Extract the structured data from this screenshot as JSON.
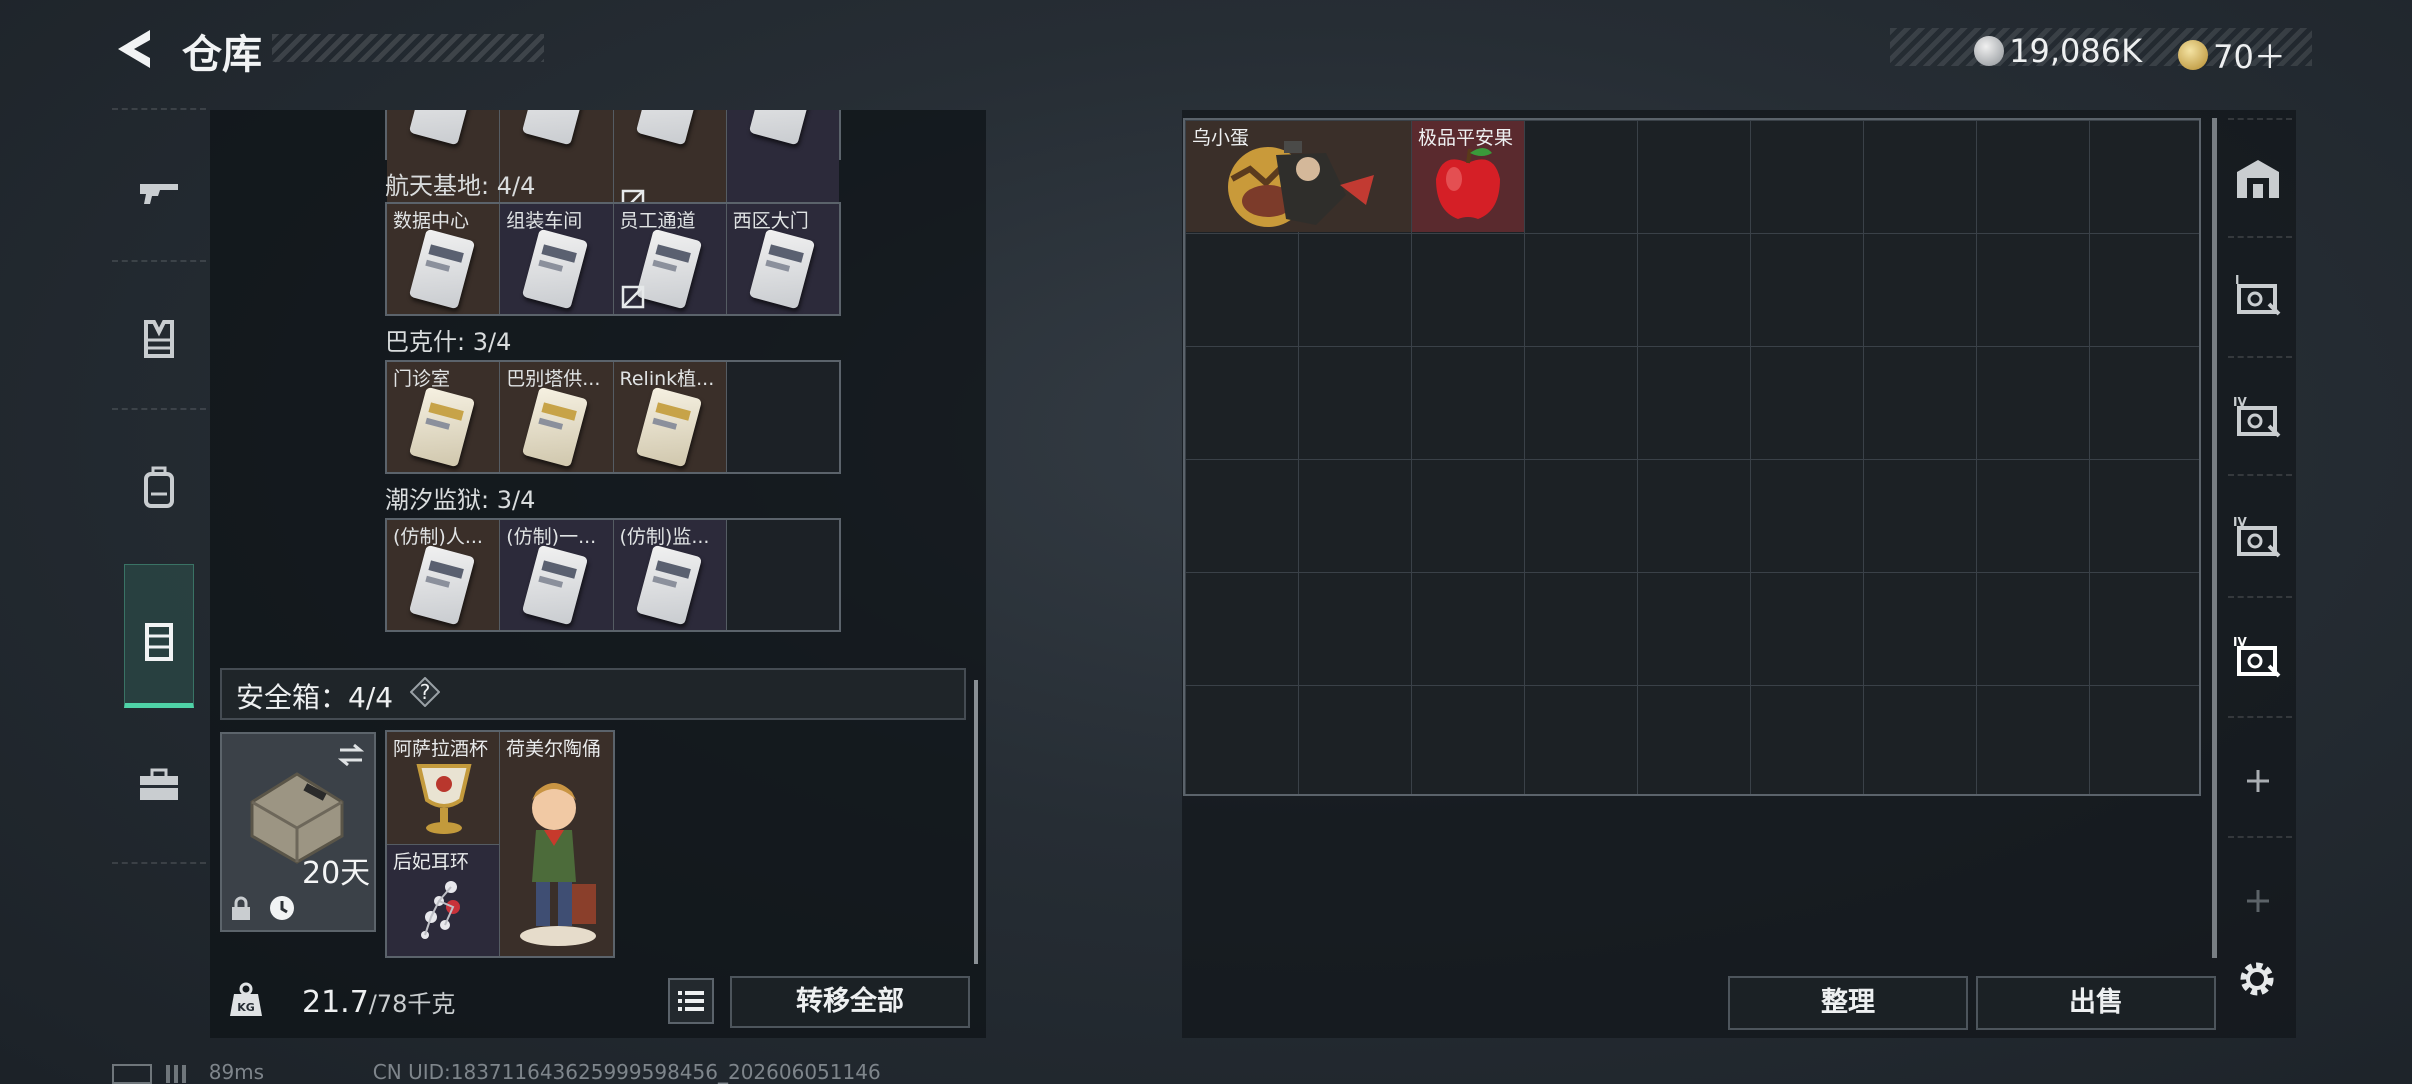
{
  "header": {
    "title": "仓库",
    "currency_1": "19,086K",
    "currency_2": "70＋"
  },
  "left_nav": {
    "items": [
      "weapon-icon",
      "vest-icon",
      "backpack-icon",
      "storage-icon",
      "toolbox-icon"
    ],
    "active": "storage-icon"
  },
  "keys": {
    "top_row_partial": [
      {
        "name": "",
        "color": "brown",
        "broken": false
      },
      {
        "name": "",
        "color": "brown",
        "broken": false
      },
      {
        "name": "",
        "color": "brown",
        "broken": true
      },
      {
        "name": "",
        "color": "purple",
        "broken": false
      }
    ],
    "sections": [
      {
        "label": "航天基地: 4/4",
        "items": [
          {
            "name": "数据中心",
            "color": "brown",
            "broken": false
          },
          {
            "name": "组装车间",
            "color": "purple",
            "broken": false
          },
          {
            "name": "员工通道",
            "color": "purple",
            "broken": true
          },
          {
            "name": "西区大门",
            "color": "purple",
            "broken": false
          }
        ]
      },
      {
        "label": "巴克什: 3/4",
        "items": [
          {
            "name": "门诊室",
            "color": "brown",
            "broken": false
          },
          {
            "name": "巴别塔供...",
            "color": "brown",
            "broken": false
          },
          {
            "name": "Relink植...",
            "color": "brown",
            "broken": false
          }
        ]
      },
      {
        "label": "潮汐监狱: 3/4",
        "items": [
          {
            "name": "(仿制)人...",
            "color": "brown",
            "broken": false
          },
          {
            "name": "(仿制)一...",
            "color": "purple",
            "broken": false
          },
          {
            "name": "(仿制)监...",
            "color": "purple",
            "broken": false
          }
        ]
      }
    ]
  },
  "safe_box": {
    "label": "安全箱：4/4",
    "help": "?",
    "days": "20天",
    "items": [
      {
        "name": "阿萨拉酒杯"
      },
      {
        "name": "荷美尔陶俑"
      },
      {
        "name": "后妃耳环"
      }
    ]
  },
  "bottom": {
    "weight": "21.7",
    "weight_max": "/78千克",
    "transfer_all": "转移全部"
  },
  "grid": {
    "columns": 9,
    "rows": 6,
    "items": [
      {
        "name": "乌小蛋"
      },
      {
        "name": "极品平安果"
      }
    ]
  },
  "right_buttons": {
    "organize": "整理",
    "sell": "出售"
  },
  "footer": {
    "ping": "89ms",
    "uid": "CN UID:18371164362599959845­6_202606051146"
  },
  "colors": {
    "accent": "#4fd3a7",
    "brown_cell": "#3a2f29",
    "purple_cell": "#2c2a3a",
    "red_cell": "#5a2a2e"
  }
}
